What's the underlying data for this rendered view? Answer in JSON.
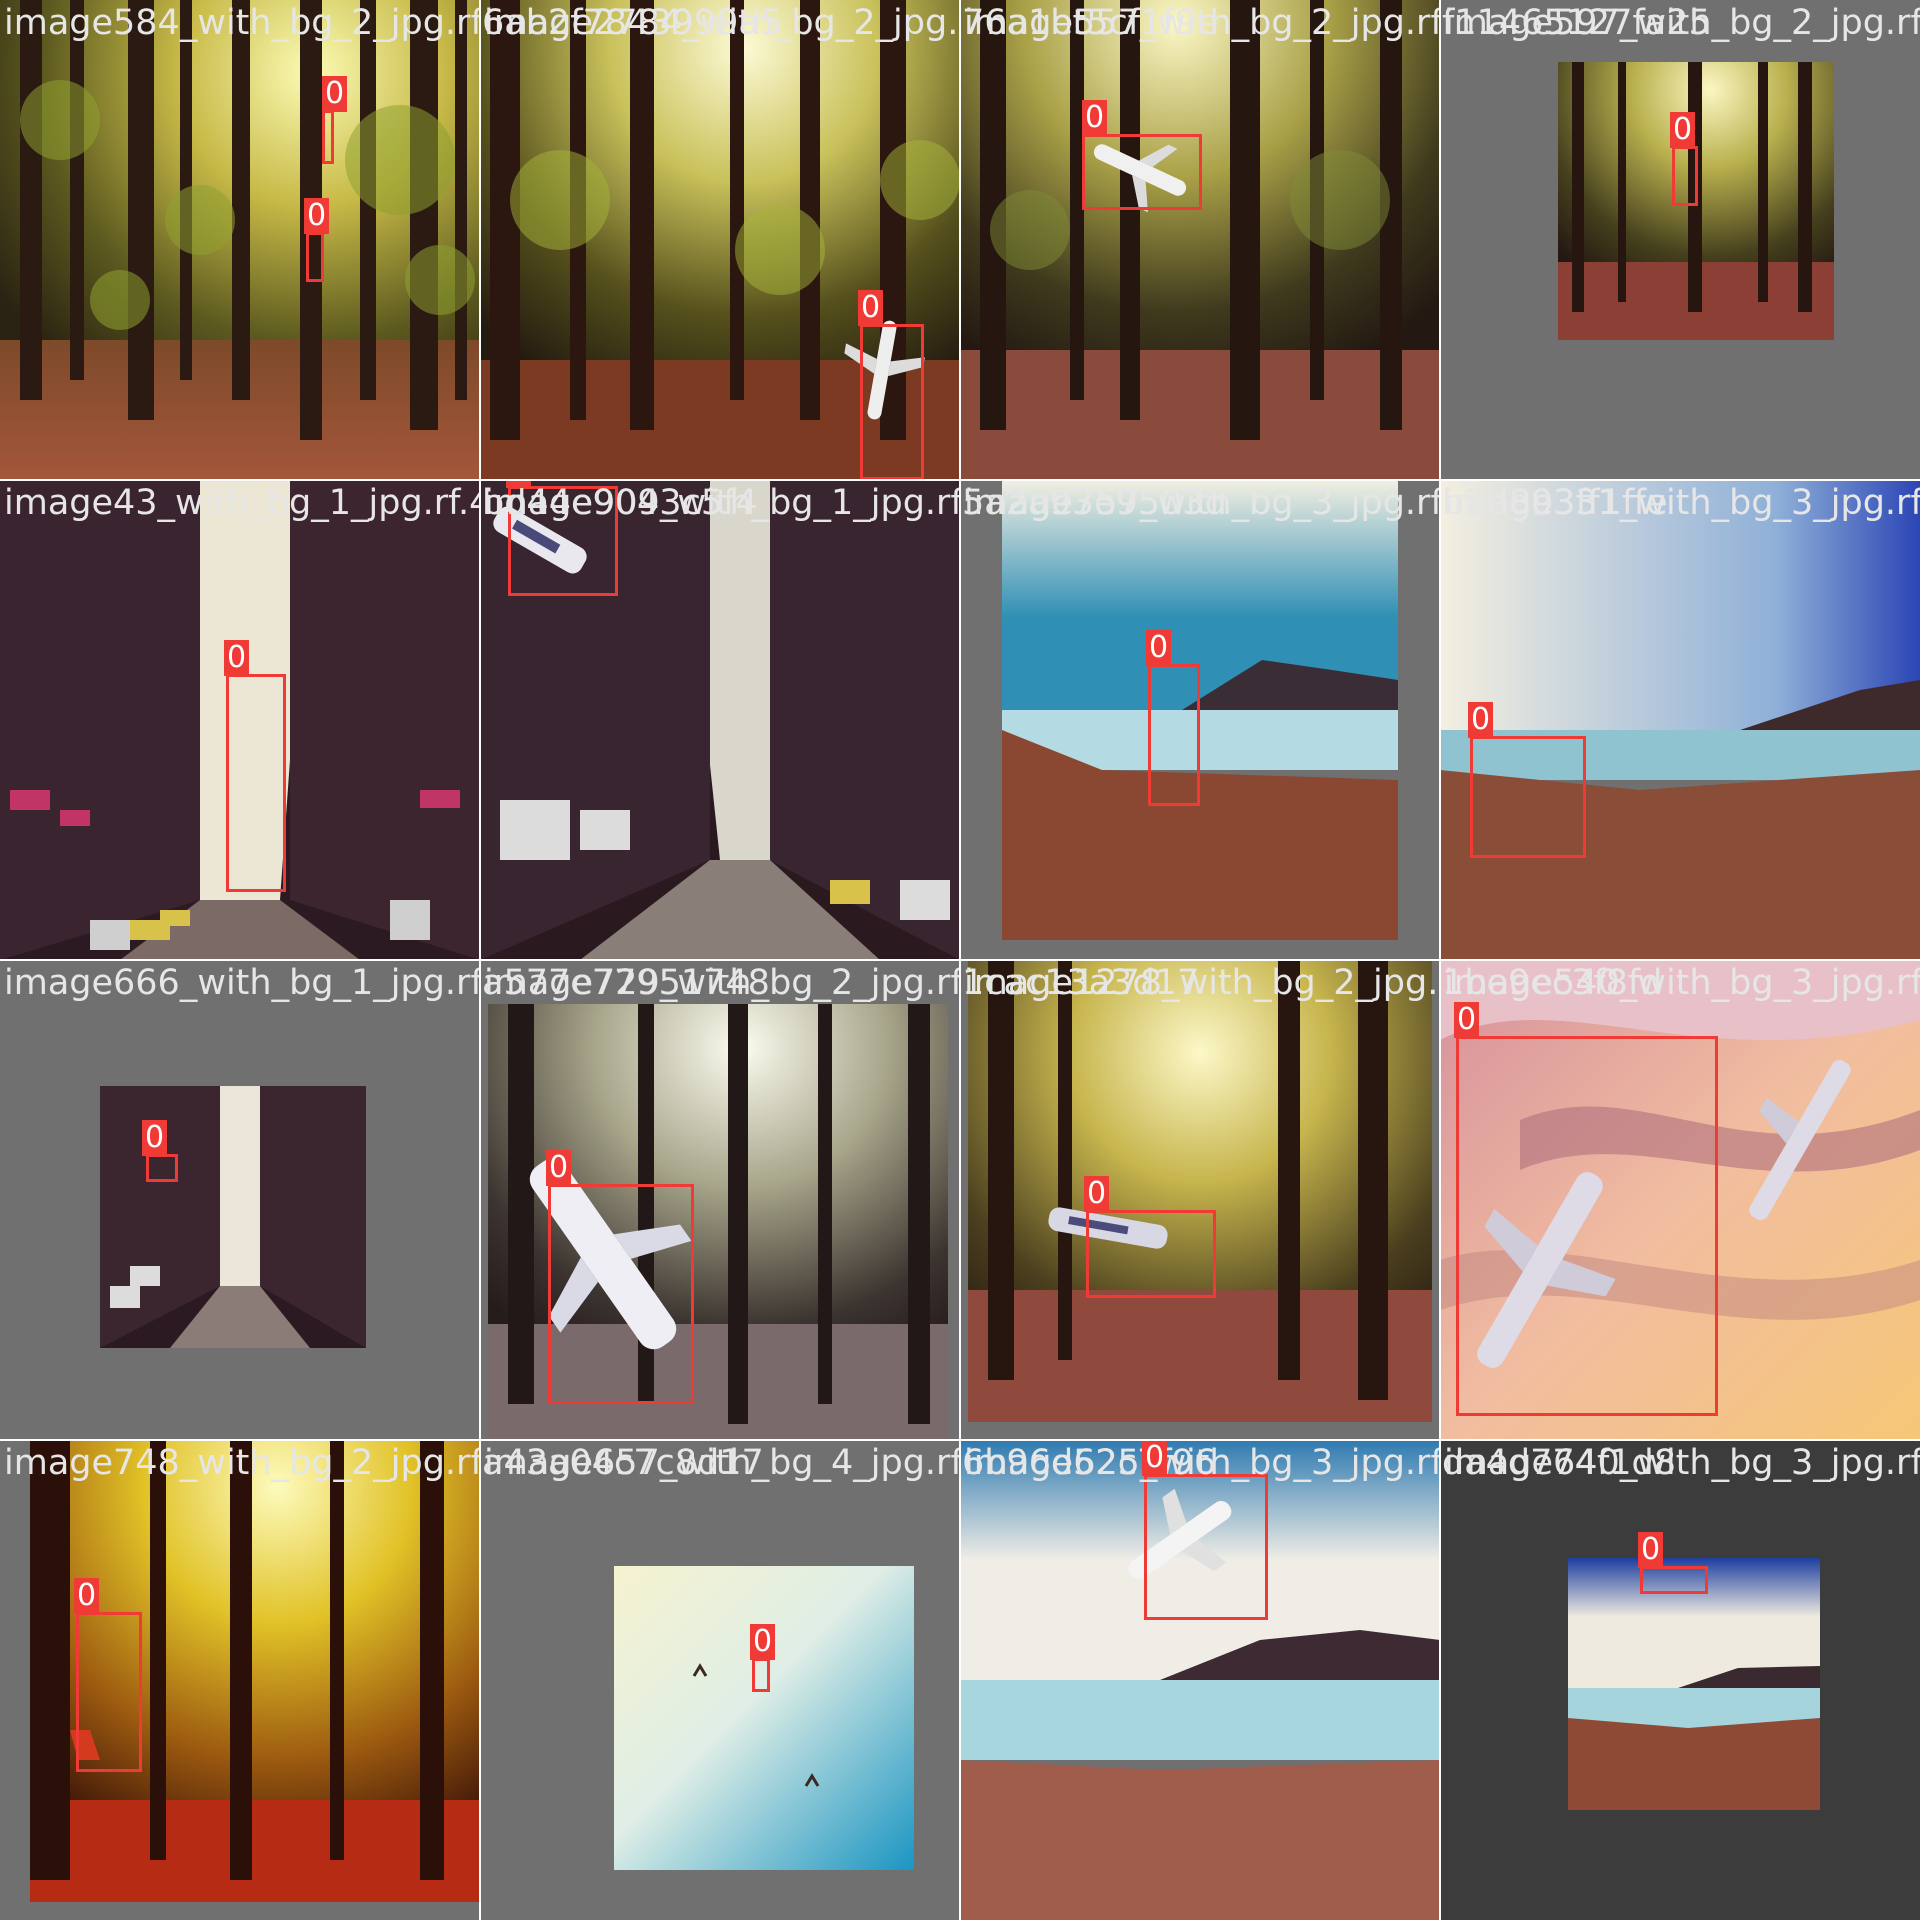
{
  "tiles": [
    {
      "label": "image584_with_bg_2_jpg.rf.",
      "detections": [
        {
          "class_label": "0"
        },
        {
          "class_label": "0"
        }
      ]
    },
    {
      "label": "image2784_with_bg_2_jpg.rf.",
      "overlay_label": "6ab2f7843999a5",
      "detections": [
        {
          "class_label": "0"
        }
      ]
    },
    {
      "label": "image557_with_bg_2_jpg.rf.",
      "overlay_label": "76a1bt5cf1f9e",
      "detections": [
        {
          "class_label": "0"
        }
      ]
    },
    {
      "label": "image597_with_bg_2_jpg.rf.",
      "overlay_label": "f11465127fa25",
      "detections": [
        {
          "class_label": "0"
        }
      ]
    },
    {
      "label": "image43_with_bg_1_jpg.rf.4",
      "detections": [
        {
          "class_label": "0"
        }
      ]
    },
    {
      "label": "image909_with_bg_1_jpg.rf.",
      "overlay_label": "bd44e9043c5f4",
      "detections": [
        {
          "class_label": "0"
        }
      ]
    },
    {
      "label": "image757_with_bg_3_jpg.rf.",
      "overlay_label": "5a2a93e9503d",
      "detections": [
        {
          "class_label": "0"
        }
      ]
    },
    {
      "label": "image331_with_bg_3_jpg.rf.",
      "overlay_label": "b2d893ff1ffe",
      "detections": [
        {
          "class_label": "0"
        }
      ]
    },
    {
      "label": "image666_with_bg_1_jpg.rf.",
      "detections": [
        {
          "class_label": "0"
        }
      ]
    },
    {
      "label": "image729_with_bg_2_jpg.rf.0",
      "overlay_label": "a577e77951748",
      "detections": [
        {
          "class_label": "0"
        }
      ]
    },
    {
      "label": "image1278_with_bg_2_jpg.rf.1",
      "overlay_label": "1cac13a3d17",
      "detections": [
        {
          "class_label": "0"
        }
      ]
    },
    {
      "label": "image540_with_bg_3_jpg.rf.",
      "overlay_label": "1be9ec3f8fd",
      "detections": [
        {
          "class_label": "0"
        }
      ]
    },
    {
      "label": "image748_with_bg_2_jpg.rf.",
      "detections": [
        {
          "class_label": "0"
        }
      ]
    },
    {
      "label": "image657_with_bg_4_jpg.rf.",
      "overlay_label": "a43a04c7c8d17",
      "detections": [
        {
          "class_label": "0"
        }
      ]
    },
    {
      "label": "image525_with_bg_3_jpg.rf.",
      "overlay_label": "6b96d62c7f96",
      "detections": [
        {
          "class_label": "0"
        }
      ]
    },
    {
      "label": "image640_with_bg_3_jpg.rf.",
      "overlay_label": "da4d774f1d8",
      "detections": [
        {
          "class_label": "0"
        }
      ]
    }
  ]
}
